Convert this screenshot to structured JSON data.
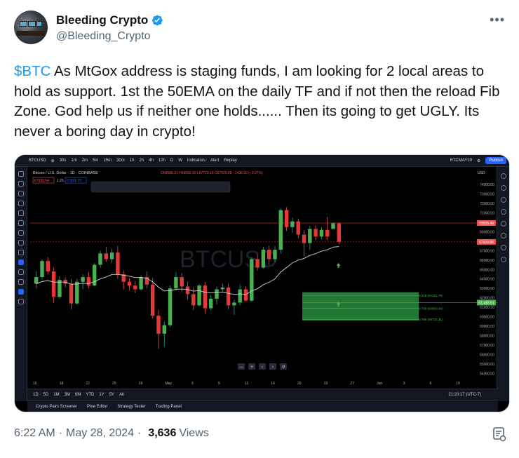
{
  "tweet": {
    "display_name": "Bleeding Crypto",
    "handle": "@Bleeding_Crypto",
    "cashtag": "$BTC",
    "text": " As MtGox address is staging funds, I am looking for 2 local areas to hold as support. 1st the 50EMA on the daily TF and if not then the reload Fib Zone. God help us if neither one holds...... Then its going to get UGLY. Its never a boring day in crypto!",
    "more_glyph": "•••",
    "time": "6:22 AM",
    "date": "May 28, 2024",
    "separator": "·",
    "views": "3,636",
    "views_label": "Views"
  },
  "chart_ui": {
    "symbol": "BTCUSD",
    "intervals": [
      "30s",
      "1m",
      "2m",
      "5m",
      "15m",
      "30m",
      "1h",
      "2h",
      "4h",
      "12h",
      "D",
      "W"
    ],
    "indicators": "Indicators",
    "alert": "Alert",
    "replay": "Replay",
    "contract": "BTCMAY19",
    "publish": "Publish",
    "currency": "USD",
    "legend_title": "Bitcoin / U.S. Dollar · 1D · COINBASE",
    "legend_ohlc": "O69588.31 H69582.90 L67723.16 C67929.88 −1436.92 (−2.07%)",
    "bid": "67930.54",
    "spread": "1.25",
    "ask": "67931.79",
    "watermark": "BTCUSD",
    "ranges": [
      "1D",
      "5D",
      "1M",
      "3M",
      "6M",
      "YTD",
      "1Y",
      "5Y",
      "All"
    ],
    "clock": "21:20:17 (UTC-7)",
    "panels": [
      "Crypto Pairs Screener",
      "Pine Editor",
      "Strategy Tester",
      "Trading Panel"
    ]
  },
  "chart_data": {
    "type": "candlestick",
    "title": "Bitcoin / U.S. Dollar · 1D · COINBASE",
    "y_ticks": [
      74000,
      73000,
      72000,
      71000,
      70000,
      69000,
      68000,
      67000,
      66000,
      65000,
      64000,
      63000,
      62000,
      61000,
      60000,
      59000,
      58000,
      57000,
      56000,
      55000,
      54000
    ],
    "y_range": [
      53500,
      75500
    ],
    "x_ticks": [
      "15",
      "18",
      "22",
      "25",
      "29",
      "May",
      "6",
      "9",
      "13",
      "16",
      "20",
      "23",
      "27",
      "Jun",
      "3",
      "6",
      "10"
    ],
    "price_labels": [
      "69928.49",
      "67929.88"
    ],
    "fib_levels": [
      {
        "label": "0.618 (62251.79)",
        "value": 62251.79
      },
      {
        "label": "0.706 (60893.44)",
        "value": 60893.44
      },
      {
        "label": "0.786 (59725.31)",
        "value": 59725.31
      }
    ],
    "ema50_label": "61,493.91",
    "candles": [
      [
        63500,
        64800,
        63000,
        64200
      ],
      [
        64200,
        66100,
        64000,
        65900
      ],
      [
        65900,
        66300,
        64500,
        64800
      ],
      [
        64800,
        65200,
        61500,
        62100
      ],
      [
        62100,
        64300,
        61900,
        63900
      ],
      [
        63900,
        64200,
        63100,
        63500
      ],
      [
        63500,
        64000,
        60800,
        61400
      ],
      [
        61400,
        64000,
        61300,
        63700
      ],
      [
        63700,
        64500,
        62900,
        64200
      ],
      [
        64200,
        64700,
        63000,
        63300
      ],
      [
        63300,
        65700,
        63200,
        65500
      ],
      [
        65500,
        67000,
        65200,
        66700
      ],
      [
        66700,
        67400,
        65800,
        66100
      ],
      [
        66100,
        67200,
        65700,
        66800
      ],
      [
        66800,
        67500,
        64000,
        64500
      ],
      [
        64500,
        64900,
        62900,
        63700
      ],
      [
        63700,
        64100,
        62800,
        63300
      ],
      [
        63300,
        63800,
        62500,
        62900
      ],
      [
        62900,
        64400,
        62800,
        64200
      ],
      [
        64200,
        64800,
        63000,
        63400
      ],
      [
        63400,
        64100,
        59800,
        60100
      ],
      [
        60100,
        60700,
        56600,
        58200
      ],
      [
        58200,
        59500,
        56800,
        59100
      ],
      [
        59100,
        63300,
        58900,
        63000
      ],
      [
        63000,
        64700,
        62800,
        64200
      ],
      [
        64200,
        64600,
        62600,
        63200
      ],
      [
        63200,
        63700,
        61800,
        62400
      ],
      [
        62400,
        63100,
        60700,
        61200
      ],
      [
        61200,
        63500,
        61100,
        63300
      ],
      [
        63300,
        63700,
        60300,
        60900
      ],
      [
        60900,
        62300,
        60700,
        61900
      ],
      [
        61900,
        63200,
        61300,
        62900
      ],
      [
        62900,
        63500,
        62600,
        63100
      ],
      [
        63100,
        63500,
        60800,
        61200
      ],
      [
        61200,
        61800,
        60200,
        61500
      ],
      [
        61500,
        63400,
        61200,
        62900
      ],
      [
        62900,
        63200,
        61600,
        61700
      ],
      [
        61700,
        66300,
        61600,
        66100
      ],
      [
        66100,
        66600,
        64900,
        65200
      ],
      [
        65200,
        67400,
        65100,
        67100
      ],
      [
        67100,
        67500,
        65500,
        66100
      ],
      [
        66100,
        67500,
        65800,
        67100
      ],
      [
        67100,
        71500,
        66700,
        71300
      ],
      [
        71300,
        71600,
        69100,
        69500
      ],
      [
        69500,
        70500,
        68900,
        70100
      ],
      [
        70100,
        70400,
        68300,
        68700
      ],
      [
        68700,
        69200,
        66400,
        67800
      ],
      [
        67800,
        69600,
        67100,
        69300
      ],
      [
        69300,
        69700,
        68100,
        68500
      ],
      [
        68500,
        69500,
        68200,
        69200
      ],
      [
        69200,
        70600,
        68100,
        68500
      ],
      [
        69300,
        70000,
        69300,
        69900
      ],
      [
        69900,
        69950,
        67700,
        67930
      ]
    ]
  }
}
